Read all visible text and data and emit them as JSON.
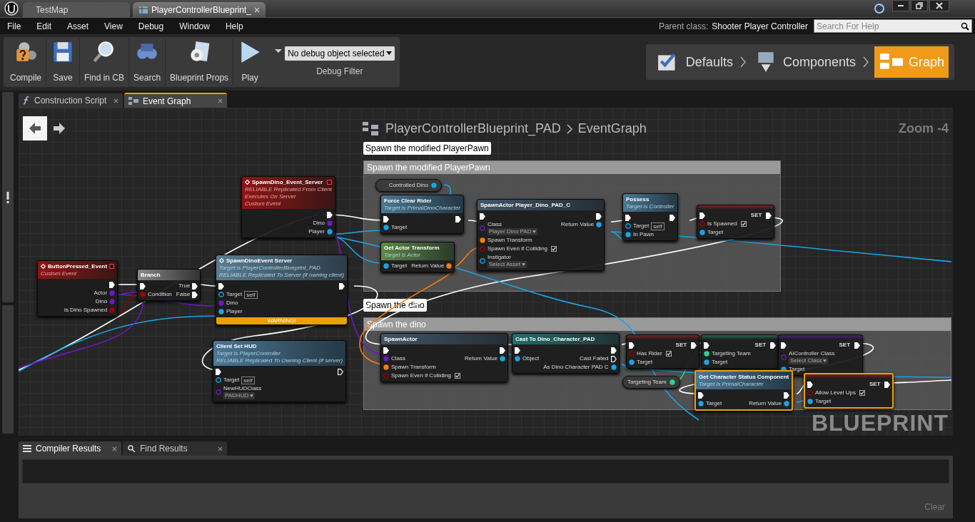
{
  "window": {
    "tabs": [
      {
        "label": "TestMap",
        "selected": false,
        "closable": false
      },
      {
        "label": "PlayerControllerBlueprint_",
        "selected": true,
        "closable": true
      }
    ]
  },
  "menu": [
    "File",
    "Edit",
    "Asset",
    "View",
    "Debug",
    "Window",
    "Help"
  ],
  "parent_class": {
    "label": "Parent class:",
    "value": "Shooter Player Controller"
  },
  "help_search": {
    "placeholder": "Search For Help"
  },
  "toolbar": {
    "buttons": [
      {
        "label": "Compile",
        "kind": "compile"
      },
      {
        "label": "Save",
        "kind": "save"
      },
      {
        "label": "Find in CB",
        "kind": "find"
      },
      {
        "label": "Search",
        "kind": "search"
      },
      {
        "label": "Blueprint Props",
        "kind": "props"
      },
      {
        "label": "Play",
        "kind": "play"
      }
    ],
    "debug_filter": {
      "value": "No debug object selected",
      "label": "Debug Filter"
    }
  },
  "modes": [
    {
      "label": "Defaults",
      "selected": false,
      "kind": "defaults"
    },
    {
      "label": "Components",
      "selected": false,
      "kind": "components"
    },
    {
      "label": "Graph",
      "selected": true,
      "kind": "graph"
    }
  ],
  "document_tabs": [
    {
      "label": "Construction Script",
      "kind": "function",
      "selected": false
    },
    {
      "label": "Event Graph",
      "kind": "graph",
      "selected": true
    }
  ],
  "graph": {
    "breadcrumb": [
      "PlayerControllerBlueprint_PAD",
      "EventGraph"
    ],
    "zoom": "Zoom -4",
    "watermark": "BLUEPRINT",
    "comments": [
      {
        "title": "Spawn the modified PlayerPawn",
        "bubble": "Spawn the modified PlayerPawn"
      },
      {
        "title": "Spawn the dino",
        "bubble": "Spawn the dino"
      }
    ],
    "nodes": [
      {
        "kind": "event",
        "title": "SpawnDino_Event_Server",
        "subtitle": [
          "RELIABLE Replicated From Client",
          "Executes On Server",
          "Custom Event"
        ],
        "selected": false,
        "outputs": [
          {
            "kind": "exec",
            "linked": true
          },
          {
            "kind": "class",
            "label": "Dino",
            "linked": true
          },
          {
            "kind": "object",
            "label": "Player",
            "linked": true
          }
        ]
      },
      {
        "kind": "event",
        "title": "ButtonPressed_Event",
        "subtitle": [
          "Custom Event"
        ],
        "selected": false,
        "outputs": [
          {
            "kind": "exec",
            "linked": true
          },
          {
            "kind": "class",
            "label": "Actor",
            "linked": true
          },
          {
            "kind": "class",
            "label": "Dino",
            "linked": true
          },
          {
            "kind": "bool",
            "label": "Is Dino Spawned",
            "linked": true
          }
        ]
      },
      {
        "kind": "branch",
        "title": "Branch",
        "selected": false,
        "inputs": [
          {
            "kind": "exec",
            "linked": true
          },
          {
            "kind": "bool",
            "label": "Condition",
            "linked": true
          }
        ],
        "outputs": [
          {
            "kind": "exec",
            "label": "True",
            "linked": true
          },
          {
            "kind": "exec",
            "label": "False",
            "linked": true
          }
        ]
      },
      {
        "kind": "call",
        "title": "SpawnDinoEvent Server",
        "subtitle": [
          "Target is PlayerControllerBlueprint_PAD",
          "RELIABLE Replicated To Server (if owning client)"
        ],
        "selected": false,
        "warning": "WARNING!",
        "inputs": [
          {
            "kind": "exec",
            "linked": true
          },
          {
            "kind": "object",
            "label": "Target",
            "linked": false,
            "value": {
              "kind": "literal",
              "text": "self"
            }
          },
          {
            "kind": "class",
            "label": "Dino",
            "linked": true
          },
          {
            "kind": "object",
            "label": "Player",
            "linked": true
          }
        ],
        "outputs": [
          {
            "kind": "exec",
            "linked": true
          }
        ]
      },
      {
        "kind": "function",
        "title": "Client Set HUD",
        "subtitle": [
          "Target is PlayerController",
          "RELIABLE Replicated To Owning Client (if server)"
        ],
        "selected": false,
        "inputs": [
          {
            "kind": "exec",
            "linked": true
          },
          {
            "kind": "object",
            "label": "Target",
            "linked": false,
            "value": {
              "kind": "literal",
              "text": "self"
            }
          },
          {
            "kind": "class",
            "label": "NewHUDClass",
            "linked": false,
            "value": {
              "kind": "dropdown",
              "text": "PADHUD"
            }
          }
        ],
        "outputs": [
          {
            "kind": "exec",
            "linked": false
          }
        ]
      },
      {
        "kind": "variable",
        "title": "Controlled Dino",
        "selected": false,
        "outputs": [
          {
            "kind": "object",
            "linked": true
          }
        ]
      },
      {
        "kind": "function",
        "title": "Force Clear Rider",
        "subtitle": [
          "Target is PrimalDinoCharacter"
        ],
        "selected": false,
        "inputs": [
          {
            "kind": "exec",
            "linked": true
          },
          {
            "kind": "object",
            "label": "Target",
            "linked": true
          }
        ],
        "outputs": [
          {
            "kind": "exec",
            "linked": true
          }
        ]
      },
      {
        "kind": "pure",
        "title": "Get Actor Transform",
        "subtitle": [
          "Target is Actor"
        ],
        "selected": false,
        "inputs": [
          {
            "kind": "object",
            "label": "Target",
            "linked": true
          }
        ],
        "outputs": [
          {
            "kind": "struct",
            "label": "Return Value",
            "linked": true
          }
        ]
      },
      {
        "kind": "spawn",
        "title": "SpawnActor Player_Dino_PAD_C",
        "selected": false,
        "inputs": [
          {
            "kind": "exec",
            "linked": true
          },
          {
            "kind": "class",
            "label": "Class",
            "linked": false,
            "value": {
              "kind": "dropdown",
              "text": "Player Dino PAD"
            }
          },
          {
            "kind": "struct",
            "label": "Spawn Transform",
            "linked": true
          },
          {
            "kind": "bool",
            "label": "Spawn Even if Colliding",
            "linked": false,
            "checked": true
          },
          {
            "kind": "object",
            "label": "Instigator",
            "linked": false,
            "value": {
              "kind": "dropdown",
              "text": "Select Asset"
            }
          }
        ],
        "outputs": [
          {
            "kind": "exec",
            "linked": true
          },
          {
            "kind": "object",
            "label": "Return Value",
            "linked": true
          }
        ]
      },
      {
        "kind": "function",
        "title": "Possess",
        "subtitle": [
          "Target is Controller"
        ],
        "selected": false,
        "inputs": [
          {
            "kind": "exec",
            "linked": true
          },
          {
            "kind": "object",
            "label": "Target",
            "linked": false,
            "value": {
              "kind": "literal",
              "text": "self"
            }
          },
          {
            "kind": "object",
            "label": "In Pawn",
            "linked": true
          }
        ],
        "outputs": [
          {
            "kind": "exec",
            "linked": true
          }
        ]
      },
      {
        "kind": "set",
        "title": "SET",
        "selected": false,
        "inputs": [
          {
            "kind": "exec",
            "linked": true
          },
          {
            "kind": "bool",
            "label": "Is Spawned",
            "linked": false,
            "checked": true
          },
          {
            "kind": "object",
            "label": "Target",
            "linked": true
          }
        ],
        "outputs": [
          {
            "kind": "exec",
            "linked": true
          }
        ]
      },
      {
        "kind": "spawn",
        "title": "SpawnActor",
        "selected": false,
        "inputs": [
          {
            "kind": "exec",
            "linked": true
          },
          {
            "kind": "class",
            "label": "Class",
            "linked": true
          },
          {
            "kind": "struct",
            "label": "Spawn Transform",
            "linked": true
          },
          {
            "kind": "bool",
            "label": "Spawn Even if Colliding",
            "linked": false,
            "checked": true
          }
        ],
        "outputs": [
          {
            "kind": "exec",
            "linked": true
          },
          {
            "kind": "object",
            "label": "Return Value",
            "linked": true
          }
        ]
      },
      {
        "kind": "cast",
        "title": "Cast To Dino_Character_PAD",
        "selected": false,
        "inputs": [
          {
            "kind": "exec",
            "linked": true
          },
          {
            "kind": "object",
            "label": "Object",
            "linked": true
          }
        ],
        "outputs": [
          {
            "kind": "exec",
            "linked": true
          },
          {
            "kind": "exec",
            "label": "Cast Failed",
            "linked": false
          },
          {
            "kind": "object",
            "label": "As Dino Character PAD C",
            "linked": true
          }
        ]
      },
      {
        "kind": "set",
        "title": "SET",
        "selected": false,
        "inputs": [
          {
            "kind": "exec",
            "linked": true
          },
          {
            "kind": "bool",
            "label": "Has Rider",
            "linked": false,
            "checked": true
          },
          {
            "kind": "object",
            "label": "Target",
            "linked": true
          }
        ],
        "outputs": [
          {
            "kind": "exec",
            "linked": true
          }
        ]
      },
      {
        "kind": "set",
        "title": "SET",
        "selected": false,
        "inputs": [
          {
            "kind": "exec",
            "linked": true
          },
          {
            "kind": "team",
            "label": "Targeting Team",
            "linked": true
          },
          {
            "kind": "object",
            "label": "Target",
            "linked": true
          }
        ],
        "outputs": [
          {
            "kind": "exec",
            "linked": true
          }
        ]
      },
      {
        "kind": "set",
        "title": "SET",
        "selected": false,
        "inputs": [
          {
            "kind": "exec",
            "linked": true
          },
          {
            "kind": "class",
            "label": "AIController Class",
            "linked": false,
            "value": {
              "kind": "dropdown",
              "text": "Select Class"
            }
          },
          {
            "kind": "object",
            "label": "Target",
            "linked": true
          }
        ],
        "outputs": [
          {
            "kind": "exec",
            "linked": true
          }
        ]
      },
      {
        "kind": "variable",
        "title": "Targeting Team",
        "selected": false,
        "outputs": [
          {
            "kind": "team",
            "linked": true
          }
        ]
      },
      {
        "kind": "function",
        "title": "Get Character Status Component",
        "subtitle": [
          "Target is PrimalCharacter"
        ],
        "selected": true,
        "inputs": [
          {
            "kind": "exec",
            "linked": true
          },
          {
            "kind": "object",
            "label": "Target",
            "linked": true
          }
        ],
        "outputs": [
          {
            "kind": "exec",
            "linked": true
          },
          {
            "kind": "object",
            "label": "Return Value",
            "linked": true
          }
        ]
      },
      {
        "kind": "set",
        "title": "SET",
        "selected": true,
        "inputs": [
          {
            "kind": "exec",
            "linked": true
          },
          {
            "kind": "bool",
            "label": "Allow Level Ups",
            "linked": false,
            "checked": true
          },
          {
            "kind": "object",
            "label": "Target",
            "linked": true
          }
        ],
        "outputs": [
          {
            "kind": "exec",
            "linked": true
          }
        ]
      }
    ]
  },
  "results_tabs": [
    {
      "label": "Compiler Results",
      "selected": true
    },
    {
      "label": "Find Results",
      "selected": false
    }
  ],
  "clear_button": "Clear"
}
